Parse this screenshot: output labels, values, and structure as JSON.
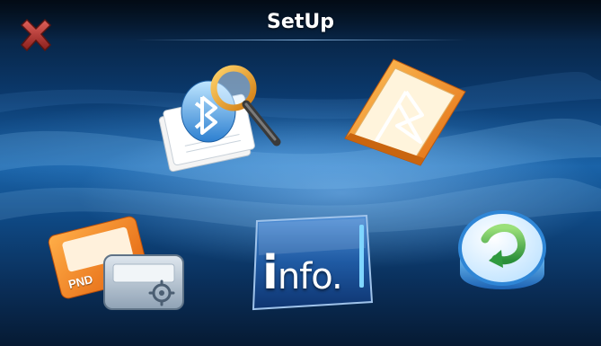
{
  "window": {
    "title": "SetUp"
  },
  "controls": {
    "close": {
      "icon": "close-x-icon"
    }
  },
  "menu": {
    "bluetooth_search": {
      "icon": "bluetooth-search-magnifier-icon"
    },
    "bluetooth_phonebook": {
      "icon": "bluetooth-folder-book-icon"
    },
    "pnd_settings": {
      "icon": "pnd-card-gear-icon",
      "label": "PND"
    },
    "info": {
      "icon": "info-panel-icon",
      "label_big": "i",
      "label_rest": "nfo."
    },
    "reset": {
      "icon": "reset-circular-arrow-icon"
    }
  },
  "colors": {
    "close_red": "#b3312e",
    "accent_blue": "#1a63a8",
    "folder_orange": "#f08a1c",
    "reset_green": "#3aa64a"
  }
}
